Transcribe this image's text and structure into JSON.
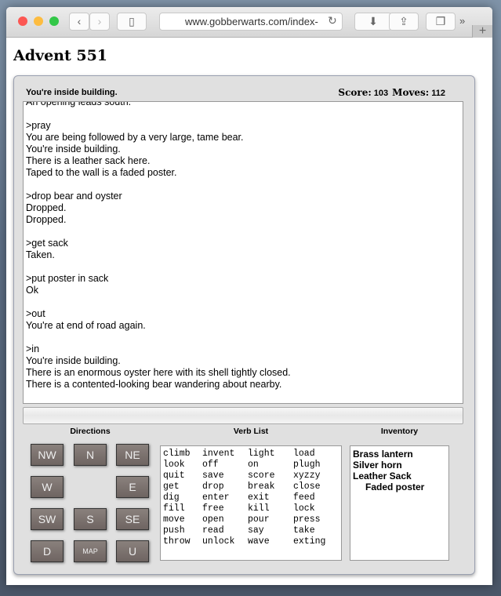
{
  "browser": {
    "url": "www.gobberwarts.com/index-",
    "back_icon": "chevron-left",
    "forward_icon": "chevron-right"
  },
  "page": {
    "title": "Advent 551"
  },
  "status": {
    "location": "You're inside building.",
    "score_label": "Score:",
    "score": "103",
    "moves_label": "Moves:",
    "moves": "112"
  },
  "transcript": [
    "An opening leads south.",
    "",
    "&gt;pray",
    "You are being followed by a very large, tame bear.",
    "You're inside building.",
    "There is a leather sack here.",
    "Taped to the wall is a faded poster.",
    "",
    "&gt;drop bear and oyster",
    "Dropped.",
    "Dropped.",
    "",
    "&gt;get sack",
    "Taken.",
    "",
    "&gt;put poster in sack",
    "Ok",
    "",
    "&gt;out",
    "You're at end of road again.",
    "",
    "&gt;in",
    "You're inside building.",
    "There is an enormous oyster here with its shell tightly closed.",
    "There is a contented-looking bear wandering about nearby."
  ],
  "command": {
    "value": ""
  },
  "directions": {
    "label": "Directions",
    "buttons": [
      "NW",
      "N",
      "NE",
      "W",
      "E",
      "SW",
      "S",
      "SE",
      "D",
      "MAP",
      "U"
    ]
  },
  "verbs": {
    "label": "Verb List",
    "items": [
      "climb",
      "invent",
      "light",
      "load",
      "look",
      "off",
      "on",
      "plugh",
      "quit",
      "save",
      "score",
      "xyzzy",
      "get",
      "drop",
      "break",
      "close",
      "dig",
      "enter",
      "exit",
      "feed",
      "fill",
      "free",
      "kill",
      "lock",
      "move",
      "open",
      "pour",
      "press",
      "push",
      "read",
      "say",
      "take",
      "throw",
      "unlock",
      "wave",
      "exting"
    ]
  },
  "inventory": {
    "label": "Inventory",
    "items": [
      {
        "name": "Brass lantern",
        "nested": false
      },
      {
        "name": "Silver horn",
        "nested": false
      },
      {
        "name": "Leather Sack",
        "nested": false
      },
      {
        "name": "Faded poster",
        "nested": true
      }
    ]
  }
}
